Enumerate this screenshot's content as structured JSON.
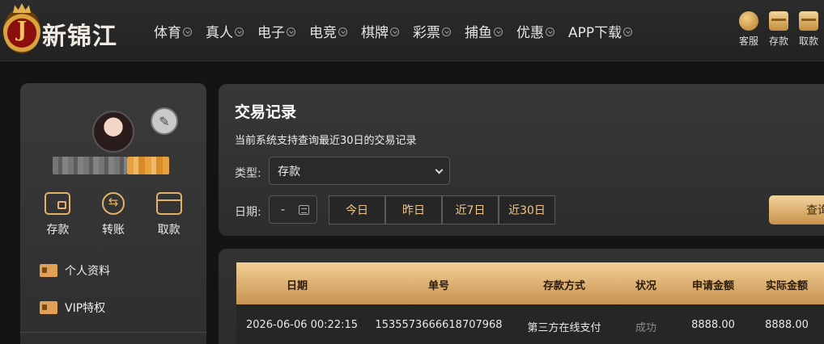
{
  "brand": {
    "logo_letter": "J",
    "name": "新锦江"
  },
  "nav": {
    "items": [
      {
        "label": "体育"
      },
      {
        "label": "真人"
      },
      {
        "label": "电子"
      },
      {
        "label": "电竞"
      },
      {
        "label": "棋牌"
      },
      {
        "label": "彩票"
      },
      {
        "label": "捕鱼"
      },
      {
        "label": "优惠"
      },
      {
        "label": "APP下载"
      }
    ],
    "quick": {
      "service": "客服",
      "deposit": "存款",
      "withdraw": "取款"
    }
  },
  "sidebar": {
    "actions": {
      "deposit": "存款",
      "transfer": "转账",
      "withdraw": "取款"
    },
    "menu": {
      "profile": "个人资料",
      "vip": "VIP特权"
    }
  },
  "filter": {
    "title": "交易记录",
    "note": "当前系统支持查询最近30日的交易记录",
    "type_label": "类型:",
    "type_value": "存款",
    "date_label": "日期:",
    "date_value": "-",
    "quick_ranges": [
      "今日",
      "昨日",
      "近7日",
      "近30日"
    ],
    "search_label": "查询"
  },
  "table": {
    "columns": [
      "日期",
      "单号",
      "存款方式",
      "状况",
      "申请金额",
      "实际金额"
    ],
    "rows": [
      [
        "2026-06-06 00:22:15",
        "1535573666618707968",
        "第三方在线支付",
        "成功",
        "8888.00",
        "8888.00"
      ]
    ]
  },
  "colors": {
    "accent": "#e6b26a",
    "header_gold": "#d9a862",
    "background": "#141414"
  }
}
